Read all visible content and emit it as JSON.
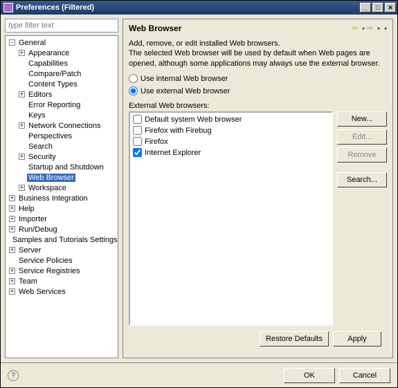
{
  "window": {
    "title": "Preferences (Filtered)"
  },
  "filter": {
    "placeholder": "type filter text"
  },
  "tree": [
    {
      "d": 0,
      "t": "-",
      "l": "General"
    },
    {
      "d": 1,
      "t": "+",
      "l": "Appearance"
    },
    {
      "d": 1,
      "t": "",
      "l": "Capabilities"
    },
    {
      "d": 1,
      "t": "",
      "l": "Compare/Patch"
    },
    {
      "d": 1,
      "t": "",
      "l": "Content Types"
    },
    {
      "d": 1,
      "t": "+",
      "l": "Editors"
    },
    {
      "d": 1,
      "t": "",
      "l": "Error Reporting"
    },
    {
      "d": 1,
      "t": "",
      "l": "Keys"
    },
    {
      "d": 1,
      "t": "+",
      "l": "Network Connections"
    },
    {
      "d": 1,
      "t": "",
      "l": "Perspectives"
    },
    {
      "d": 1,
      "t": "",
      "l": "Search"
    },
    {
      "d": 1,
      "t": "+",
      "l": "Security"
    },
    {
      "d": 1,
      "t": "",
      "l": "Startup and Shutdown"
    },
    {
      "d": 1,
      "t": "",
      "l": "Web Browser",
      "sel": true
    },
    {
      "d": 1,
      "t": "+",
      "l": "Workspace"
    },
    {
      "d": 0,
      "t": "+",
      "l": "Business Integration"
    },
    {
      "d": 0,
      "t": "+",
      "l": "Help"
    },
    {
      "d": 0,
      "t": "+",
      "l": "Importer"
    },
    {
      "d": 0,
      "t": "+",
      "l": "Run/Debug"
    },
    {
      "d": 0,
      "t": "",
      "l": "Samples and Tutorials Settings"
    },
    {
      "d": 0,
      "t": "+",
      "l": "Server"
    },
    {
      "d": 0,
      "t": "",
      "l": "Service Policies"
    },
    {
      "d": 0,
      "t": "+",
      "l": "Service Registries"
    },
    {
      "d": 0,
      "t": "+",
      "l": "Team"
    },
    {
      "d": 0,
      "t": "+",
      "l": "Web Services"
    }
  ],
  "page": {
    "title": "Web Browser",
    "desc1": "Add, remove, or edit installed Web browsers.",
    "desc2": "The selected Web browser will be used by default when Web pages are opened, although some applications may always use the external browser.",
    "radio_internal": "Use internal Web browser",
    "radio_external": "Use external Web browser",
    "ext_label": "External Web browsers:",
    "browsers": [
      {
        "l": "Default system Web browser",
        "c": false
      },
      {
        "l": "Firefox with Firebug",
        "c": false
      },
      {
        "l": "Firefox",
        "c": false
      },
      {
        "l": "Internet Explorer",
        "c": true
      }
    ],
    "btn_new": "New...",
    "btn_edit": "Edit...",
    "btn_remove": "Remove",
    "btn_search": "Search...",
    "btn_restore": "Restore Defaults",
    "btn_apply": "Apply"
  },
  "footer": {
    "ok": "OK",
    "cancel": "Cancel"
  }
}
